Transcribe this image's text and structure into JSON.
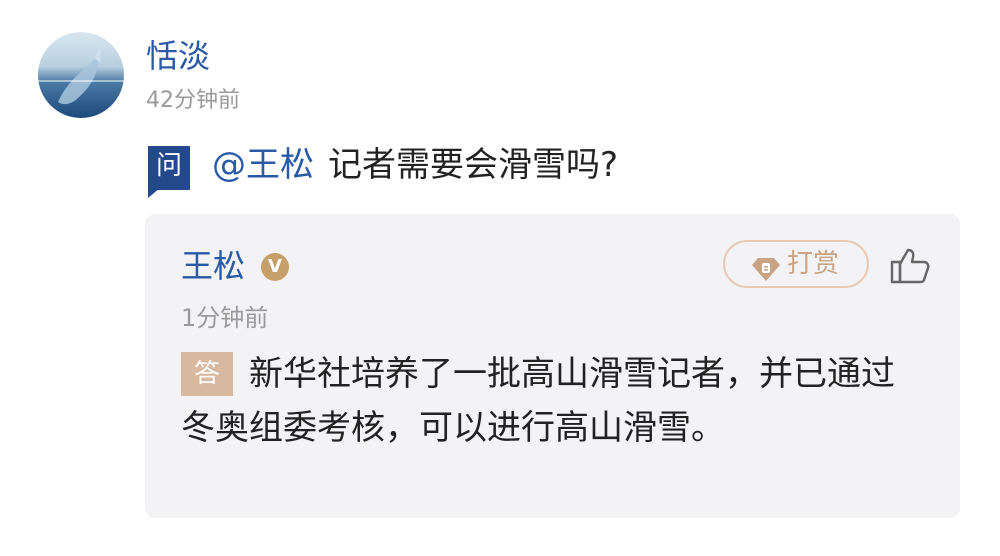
{
  "question_post": {
    "user_name": "恬淡",
    "time": "42分钟前",
    "badge": "问",
    "mention": "@王松",
    "text": "记者需要会滑雪吗?"
  },
  "answer_card": {
    "name": "王松",
    "verified_badge": "V",
    "tip_label": "打赏",
    "time": "1分钟前",
    "badge": "答",
    "text": "新华社培养了一批高山滑雪记者，并已通过冬奥组委考核，可以进行高山滑雪。"
  },
  "icons": {
    "avatar": "avatar-whale",
    "tip": "diamond-coin-icon",
    "like": "thumbs-up-icon"
  },
  "colors": {
    "link_blue": "#2a5aa6",
    "question_badge": "#23498a",
    "answer_badge": "#d8b89f",
    "tip_outline": "#e8c9b3",
    "card_bg": "#f3f3f5"
  }
}
